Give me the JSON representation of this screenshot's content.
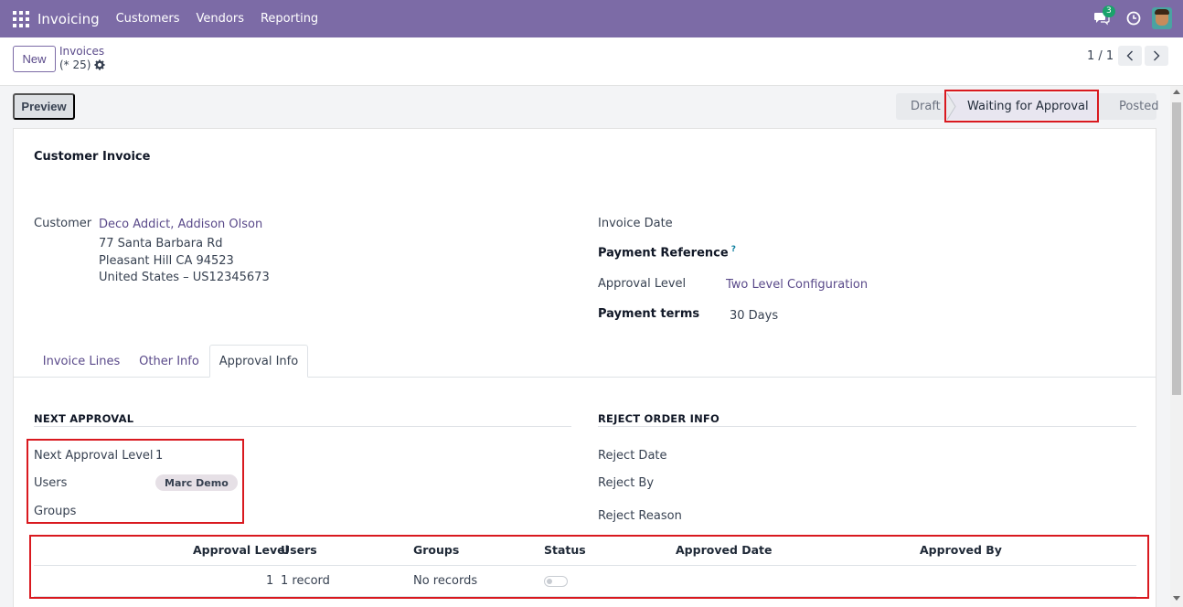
{
  "topbar": {
    "app_name": "Invoicing",
    "menu": [
      "Customers",
      "Vendors",
      "Reporting"
    ],
    "chat_badge": "3",
    "brand_color": "#7c6ba6"
  },
  "control": {
    "new_label": "New",
    "breadcrumb": "Invoices",
    "record_count": "(* 25)",
    "pager": "1 / 1"
  },
  "statusbar": {
    "preview_label": "Preview",
    "stages": [
      "Draft",
      "Waiting for Approval",
      "Posted"
    ],
    "active_stage": "Waiting for Approval"
  },
  "form": {
    "title": "Customer Invoice",
    "customer_label": "Customer",
    "customer_name": "Deco Addict, Addison Olson",
    "address_line1": "77 Santa Barbara Rd",
    "address_line2": "Pleasant Hill CA 94523",
    "address_line3": "United States – US12345673",
    "invoice_date_label": "Invoice Date",
    "payment_reference_label": "Payment Reference",
    "help_mark": "?",
    "approval_level_label": "Approval Level",
    "approval_level_value": "Two Level Configuration",
    "payment_terms_label": "Payment terms",
    "payment_terms_value": "30 Days"
  },
  "tabs": [
    "Invoice Lines",
    "Other Info",
    "Approval Info"
  ],
  "active_tab": "Approval Info",
  "next_approval": {
    "section_title": "NEXT APPROVAL",
    "level_label": "Next Approval Level",
    "level_value": "1",
    "users_label": "Users",
    "user_tag": "Marc Demo",
    "groups_label": "Groups"
  },
  "reject_info": {
    "section_title": "REJECT ORDER INFO",
    "reject_date_label": "Reject Date",
    "reject_by_label": "Reject By",
    "reject_reason_label": "Reject Reason"
  },
  "approval_table": {
    "columns": [
      "Approval Level",
      "Users",
      "Groups",
      "Status",
      "Approved Date",
      "Approved By"
    ],
    "rows": [
      {
        "approval_level": "1",
        "users": "1 record",
        "groups": "No records",
        "status": false,
        "approved_date": "",
        "approved_by": ""
      }
    ]
  }
}
